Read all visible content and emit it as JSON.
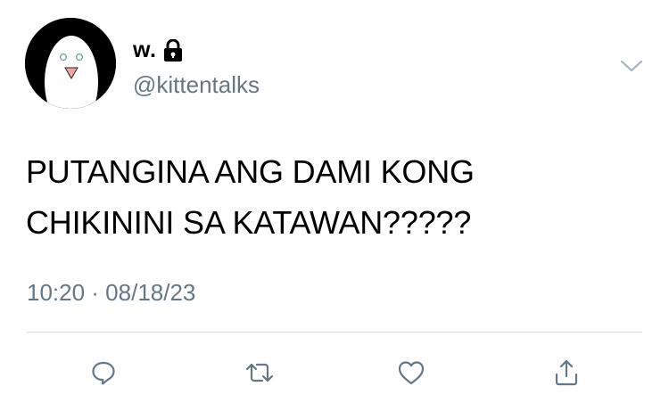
{
  "user": {
    "display_name": "w.",
    "handle": "@kittentalks"
  },
  "tweet": {
    "lines": [
      "PUTANGINA ANG DAMI KONG",
      "CHIKININI SA KATAWAN?????"
    ],
    "timestamp": "10:20 · 08/18/23"
  },
  "icons": {
    "lock": "lock-icon",
    "menu": "chevron-down-icon",
    "reply": "reply-icon",
    "retweet": "retweet-icon",
    "like": "heart-icon",
    "share": "share-icon"
  },
  "colors": {
    "text": "#000000",
    "secondary": "#657786",
    "divider": "#d9dde1"
  }
}
